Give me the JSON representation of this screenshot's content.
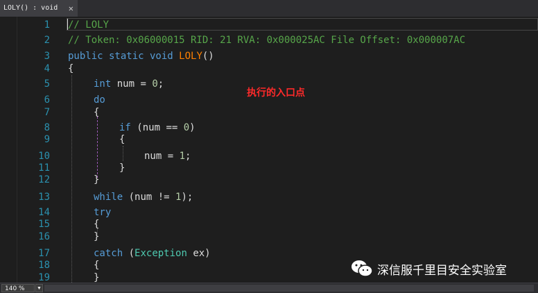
{
  "tab": {
    "title": "LOLY() : void",
    "close": "✕"
  },
  "line_numbers": [
    "1",
    "2",
    "3",
    "4",
    "5",
    "6",
    "7",
    "8",
    "9",
    "10",
    "11",
    "12",
    "13",
    "14",
    "15",
    "16",
    "17",
    "18",
    "19"
  ],
  "code": {
    "l1": "// LOLY",
    "l2": "// Token: 0x06000015 RID: 21 RVA: 0x000025AC File Offset: 0x000007AC",
    "l3_kw": "public static void",
    "l3_fn": "LOLY",
    "l3_paren": "()",
    "open_brace": "{",
    "close_brace": "}",
    "kw_int": "int",
    "l5_rest": "num = ",
    "zero": "0",
    "one": "1",
    "semicolon": ";",
    "kw_do": "do",
    "kw_if": "if",
    "l8_rest": "(num == ",
    "l8_end": ")",
    "l10_rest": "num = ",
    "kw_while": "while",
    "l13_rest": "(num != ",
    "l13_end": ");",
    "kw_try": "try",
    "kw_catch": "catch",
    "paren_open": "(",
    "type_exception": "Exception",
    "l17_rest": " ex)"
  },
  "annotation": "执行的入口点",
  "watermark": "深信服千里目安全实验室",
  "zoom": "140 %",
  "zoom_arrow": "▼",
  "colors": {
    "background": "#1e1e1e",
    "keyword": "#569cd6",
    "comment": "#57a64a",
    "method": "#ff8000",
    "type": "#4ec9b0",
    "number": "#b5cea8",
    "line_number": "#2b91af",
    "annotation": "#ff2a2a"
  }
}
